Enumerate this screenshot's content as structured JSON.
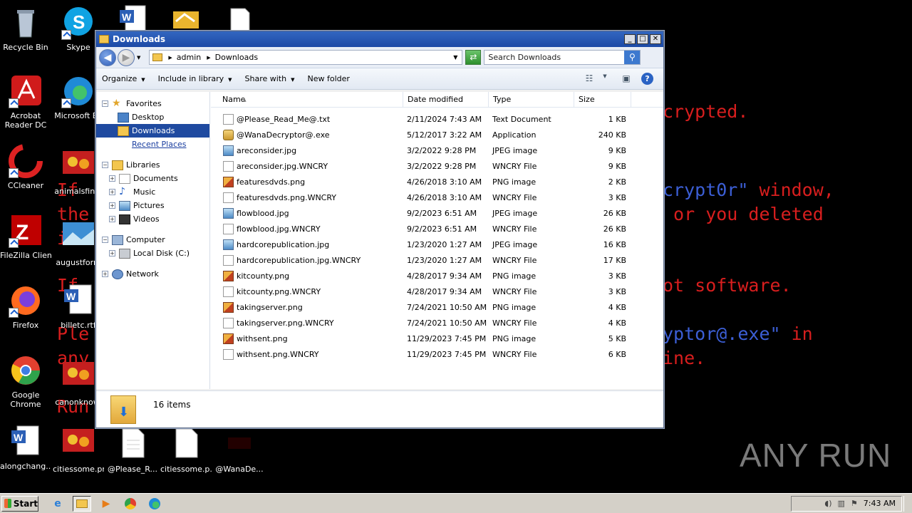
{
  "background_text": {
    "encrypted": "crypted.",
    "line2_left": "If",
    "line2_blue": "crypt0r\"",
    "line2_red": " window,",
    "line3_left": "the",
    "line3_right": " or you deleted",
    "line4_left": "i",
    "line5_left": "If",
    "line5_right": "ot software.",
    "line6_left": "Ple",
    "line6_blue": "yptor@.exe\"",
    "line6_red": " in",
    "line7_left": "any",
    "line7_right": "ine.",
    "line8_left": "Run"
  },
  "desktop_icons": [
    {
      "label": "Recycle Bin",
      "icon": "recycle-bin-icon"
    },
    {
      "label": "Skype",
      "icon": "skype-icon"
    },
    {
      "label": "Acrobat Reader DC",
      "icon": "acrobat-icon"
    },
    {
      "label": "Microsoft Ed",
      "icon": "edge-icon"
    },
    {
      "label": "CCleaner",
      "icon": "ccleaner-icon"
    },
    {
      "label": "animalsfind.",
      "icon": "image-file-icon"
    },
    {
      "label": "FileZilla Client",
      "icon": "filezilla-icon"
    },
    {
      "label": "augustform",
      "icon": "image-file-icon"
    },
    {
      "label": "Firefox",
      "icon": "firefox-icon"
    },
    {
      "label": "billetc.rtf",
      "icon": "word-document-icon"
    },
    {
      "label": "Google Chrome",
      "icon": "chrome-icon"
    },
    {
      "label": "canonknowl",
      "icon": "image-file-icon"
    },
    {
      "label": "alongchang...",
      "icon": "word-document-icon"
    },
    {
      "label": "citiessome.png",
      "icon": "image-file-icon"
    },
    {
      "label": "@Please_R...",
      "icon": "text-file-icon"
    },
    {
      "label": "citiessome.p...",
      "icon": "file-icon"
    },
    {
      "label": "@WanaDe...",
      "icon": "wanadecryptor-icon"
    }
  ],
  "window": {
    "title": "Downloads",
    "address": {
      "root": "admin",
      "current": "Downloads"
    },
    "search_placeholder": "Search Downloads",
    "toolbar": {
      "organize": "Organize",
      "include": "Include in library",
      "share": "Share with",
      "newfolder": "New folder"
    },
    "nav": {
      "favorites": "Favorites",
      "desktop": "Desktop",
      "downloads": "Downloads",
      "recent": "Recent Places",
      "libraries": "Libraries",
      "documents": "Documents",
      "music": "Music",
      "pictures": "Pictures",
      "videos": "Videos",
      "computer": "Computer",
      "localdisk": "Local Disk (C:)",
      "network": "Network"
    },
    "columns": {
      "name": "Name",
      "date": "Date modified",
      "type": "Type",
      "size": "Size"
    },
    "files": [
      {
        "name": "@Please_Read_Me@.txt",
        "date": "2/11/2024 7:43 AM",
        "type": "Text Document",
        "size": "1 KB",
        "kind": "doc"
      },
      {
        "name": "@WanaDecryptor@.exe",
        "date": "5/12/2017 3:22 AM",
        "type": "Application",
        "size": "240 KB",
        "kind": "exe"
      },
      {
        "name": "areconsider.jpg",
        "date": "3/2/2022 9:28 PM",
        "type": "JPEG image",
        "size": "9 KB",
        "kind": "img"
      },
      {
        "name": "areconsider.jpg.WNCRY",
        "date": "3/2/2022 9:28 PM",
        "type": "WNCRY File",
        "size": "9 KB",
        "kind": "doc"
      },
      {
        "name": "featuresdvds.png",
        "date": "4/26/2018 3:10 AM",
        "type": "PNG image",
        "size": "2 KB",
        "kind": "png"
      },
      {
        "name": "featuresdvds.png.WNCRY",
        "date": "4/26/2018 3:10 AM",
        "type": "WNCRY File",
        "size": "3 KB",
        "kind": "doc"
      },
      {
        "name": "flowblood.jpg",
        "date": "9/2/2023 6:51 AM",
        "type": "JPEG image",
        "size": "26 KB",
        "kind": "img"
      },
      {
        "name": "flowblood.jpg.WNCRY",
        "date": "9/2/2023 6:51 AM",
        "type": "WNCRY File",
        "size": "26 KB",
        "kind": "doc"
      },
      {
        "name": "hardcorepublication.jpg",
        "date": "1/23/2020 1:27 AM",
        "type": "JPEG image",
        "size": "16 KB",
        "kind": "img"
      },
      {
        "name": "hardcorepublication.jpg.WNCRY",
        "date": "1/23/2020 1:27 AM",
        "type": "WNCRY File",
        "size": "17 KB",
        "kind": "doc"
      },
      {
        "name": "kitcounty.png",
        "date": "4/28/2017 9:34 AM",
        "type": "PNG image",
        "size": "3 KB",
        "kind": "png"
      },
      {
        "name": "kitcounty.png.WNCRY",
        "date": "4/28/2017 9:34 AM",
        "type": "WNCRY File",
        "size": "3 KB",
        "kind": "doc"
      },
      {
        "name": "takingserver.png",
        "date": "7/24/2021 10:50 AM",
        "type": "PNG image",
        "size": "4 KB",
        "kind": "png"
      },
      {
        "name": "takingserver.png.WNCRY",
        "date": "7/24/2021 10:50 AM",
        "type": "WNCRY File",
        "size": "4 KB",
        "kind": "doc"
      },
      {
        "name": "withsent.png",
        "date": "11/29/2023 7:45 PM",
        "type": "PNG image",
        "size": "5 KB",
        "kind": "png"
      },
      {
        "name": "withsent.png.WNCRY",
        "date": "11/29/2023 7:45 PM",
        "type": "WNCRY File",
        "size": "6 KB",
        "kind": "doc"
      }
    ],
    "status": "16 items"
  },
  "taskbar": {
    "start": "Start",
    "clock": "7:43 AM"
  },
  "watermark": "ANY RUN"
}
